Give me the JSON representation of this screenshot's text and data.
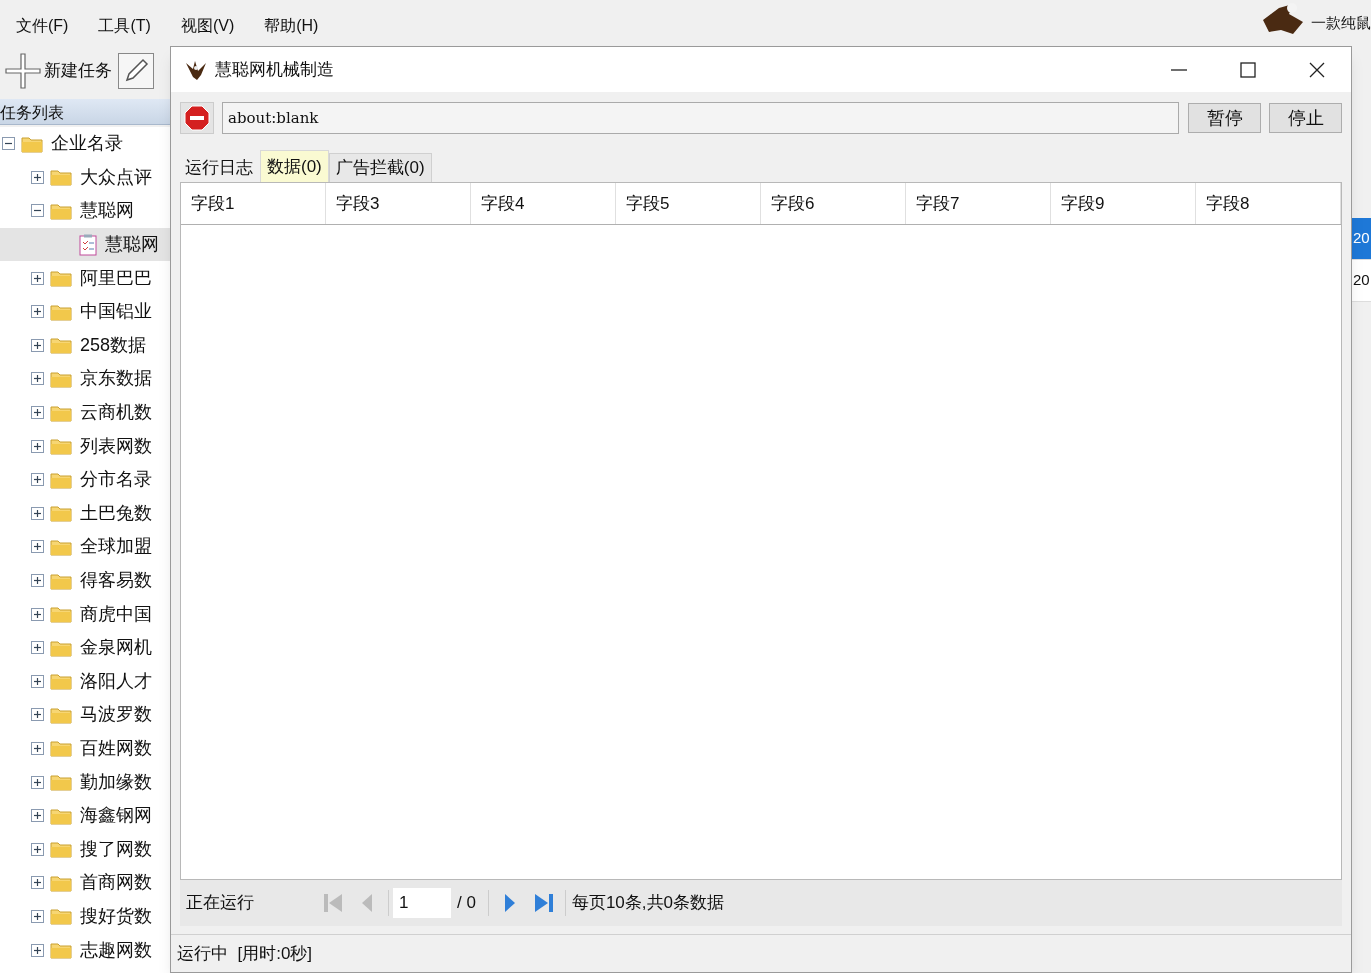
{
  "menu": [
    "文件(F)",
    "工具(T)",
    "视图(V)",
    "帮助(H)"
  ],
  "toolbar": {
    "new_task": "新建任务"
  },
  "brand": {
    "tagline": "一款纯鼠"
  },
  "sidebar": {
    "title": "任务列表",
    "tree": [
      {
        "label": "企业名录",
        "kind": "folder",
        "expanded": true,
        "selected": false,
        "children": [
          {
            "label": "大众点评",
            "kind": "folder",
            "expanded": false,
            "selected": false
          },
          {
            "label": "慧聪网",
            "kind": "folder",
            "expanded": true,
            "selected": false,
            "children": [
              {
                "label": "慧聪网",
                "kind": "task",
                "selected": true
              }
            ]
          },
          {
            "label": "阿里巴巴",
            "kind": "folder",
            "expanded": false,
            "selected": false
          },
          {
            "label": "中国铝业",
            "kind": "folder",
            "expanded": false,
            "selected": false
          },
          {
            "label": "258数据",
            "kind": "folder",
            "expanded": false,
            "selected": false
          },
          {
            "label": "京东数据",
            "kind": "folder",
            "expanded": false,
            "selected": false
          },
          {
            "label": "云商机数",
            "kind": "folder",
            "expanded": false,
            "selected": false
          },
          {
            "label": "列表网数",
            "kind": "folder",
            "expanded": false,
            "selected": false
          },
          {
            "label": "分市名录",
            "kind": "folder",
            "expanded": false,
            "selected": false
          },
          {
            "label": "土巴兔数",
            "kind": "folder",
            "expanded": false,
            "selected": false
          },
          {
            "label": "全球加盟",
            "kind": "folder",
            "expanded": false,
            "selected": false
          },
          {
            "label": "得客易数",
            "kind": "folder",
            "expanded": false,
            "selected": false
          },
          {
            "label": "商虎中国",
            "kind": "folder",
            "expanded": false,
            "selected": false
          },
          {
            "label": "金泉网机",
            "kind": "folder",
            "expanded": false,
            "selected": false
          },
          {
            "label": "洛阳人才",
            "kind": "folder",
            "expanded": false,
            "selected": false
          },
          {
            "label": "马波罗数",
            "kind": "folder",
            "expanded": false,
            "selected": false
          },
          {
            "label": "百姓网数",
            "kind": "folder",
            "expanded": false,
            "selected": false
          },
          {
            "label": "勤加缘数",
            "kind": "folder",
            "expanded": false,
            "selected": false
          },
          {
            "label": "海鑫钢网",
            "kind": "folder",
            "expanded": false,
            "selected": false
          },
          {
            "label": "搜了网数",
            "kind": "folder",
            "expanded": false,
            "selected": false
          },
          {
            "label": "首商网数",
            "kind": "folder",
            "expanded": false,
            "selected": false
          },
          {
            "label": "搜好货数",
            "kind": "folder",
            "expanded": false,
            "selected": false
          },
          {
            "label": "志趣网数",
            "kind": "folder",
            "expanded": false,
            "selected": false
          }
        ]
      }
    ]
  },
  "background_rows": [
    {
      "text": "20",
      "selected": true
    },
    {
      "text": "20",
      "selected": false
    }
  ],
  "dialog": {
    "title": "慧聪网机械制造",
    "url": "about:blank",
    "buttons": [
      "暂停",
      "停止"
    ],
    "tabs": [
      {
        "label": "运行日志",
        "selected": false
      },
      {
        "label": "数据(0)",
        "selected": true
      },
      {
        "label": "广告拦截(0)",
        "selected": false
      }
    ],
    "columns": [
      "字段1",
      "字段3",
      "字段4",
      "字段5",
      "字段6",
      "字段7",
      "字段9",
      "字段8"
    ],
    "pager": {
      "status": "正在运行",
      "page": "1",
      "total": "/ 0",
      "info": "每页10条,共0条数据"
    },
    "status_bar": "运行中  [用时:0秒]"
  }
}
